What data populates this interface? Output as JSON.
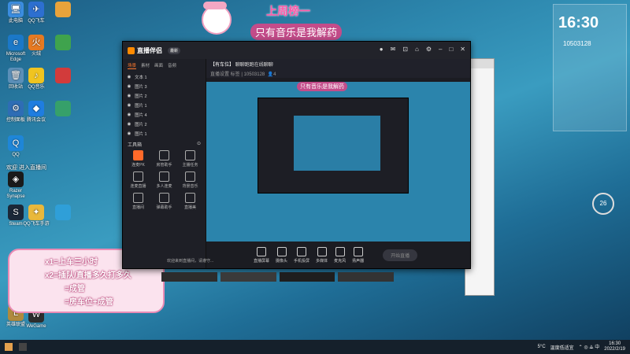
{
  "desktop": {
    "icons": [
      {
        "label": "此电脑",
        "bg": "#3b8de0",
        "glyph": "🖥"
      },
      {
        "label": "Microsoft Edge",
        "bg": "#1b78c8",
        "glyph": "e"
      },
      {
        "label": "回收站",
        "bg": "#5b8fb8",
        "glyph": "🗑"
      },
      {
        "label": "控制面板",
        "bg": "#2e6db5",
        "glyph": "⚙"
      },
      {
        "label": "QQ",
        "bg": "#1e86d8",
        "glyph": "Q"
      },
      {
        "label": "Razer Synapse",
        "bg": "#1a1a1a",
        "glyph": "◈"
      },
      {
        "label": "Steam",
        "bg": "#1b2838",
        "glyph": "S"
      },
      {
        "label": "英雄联盟",
        "bg": "#b08a3e",
        "glyph": "L"
      }
    ],
    "col2": [
      {
        "label": "QQ飞车",
        "bg": "#2d6fd0",
        "glyph": "✈"
      },
      {
        "label": "火绒",
        "bg": "#e67a22",
        "glyph": "火"
      },
      {
        "label": "QQ音乐",
        "bg": "#f0c420",
        "glyph": "♪"
      },
      {
        "label": "腾讯会议",
        "bg": "#1f7de0",
        "glyph": "◆"
      },
      {
        "label": "QQ飞车手游",
        "bg": "#e9b83b",
        "glyph": "✦"
      },
      {
        "label": "WeGame",
        "bg": "#2d2d2d",
        "glyph": "W"
      }
    ],
    "welcome_text": "欢迎        进入直播间"
  },
  "overlay": {
    "banner_title": "上周榜一",
    "banner_sub": "只有音乐是我解药",
    "rules": [
      "x1=上车三小时",
      "x2=插队/直播多久打多久",
      "=成管",
      "=房车位+成管"
    ]
  },
  "app": {
    "title": "直播伴侣",
    "version": "最新",
    "room_title": "【有车位】",
    "room_desc": "聊聊跑跑在线聊聊",
    "room_meta": "直播设置  标签  |  10503128",
    "fans": "4",
    "tabs": [
      "场景",
      "素材",
      "画面",
      "音频"
    ],
    "scenes": [
      "文本 1",
      "图片 3",
      "图片 2",
      "图片 1",
      "图片 4",
      "图片 2",
      "图片 1"
    ],
    "tools_title": "工具箱",
    "tools": [
      {
        "label": "连麦PK",
        "hl": true
      },
      {
        "label": "房管助手",
        "hl": false
      },
      {
        "label": "主播任务",
        "hl": false
      },
      {
        "label": "连麦直播",
        "hl": false
      },
      {
        "label": "多人连麦",
        "hl": false
      },
      {
        "label": "背景音乐",
        "hl": false
      },
      {
        "label": "直播间",
        "hl": false
      },
      {
        "label": "弹幕助手",
        "hl": false
      },
      {
        "label": "直播美",
        "hl": false
      }
    ],
    "bottom": [
      "直播屏幕",
      "摄像头",
      "手机投屏",
      "多媒体",
      "麦克风",
      "扬声器"
    ],
    "start_btn": "开始直播",
    "chat_hint": "欢迎来到直播间，请遵守..."
  },
  "clock": {
    "time": "16:30",
    "date": "2022/2/19",
    "big_time": "16:30",
    "room": "10503128"
  },
  "weather": {
    "temp": "5°C",
    "desc": "温度低适宜"
  },
  "gauge": {
    "value": "26"
  }
}
